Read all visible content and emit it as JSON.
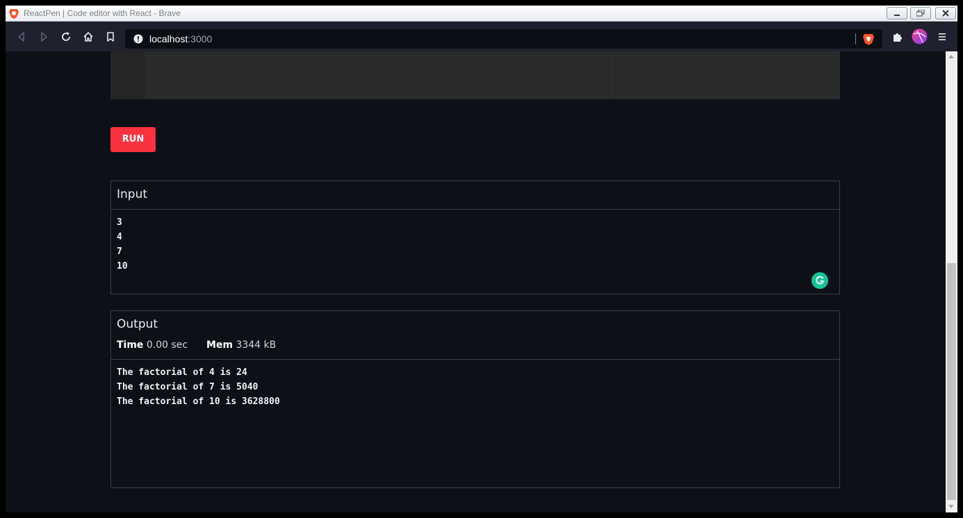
{
  "window": {
    "title": "ReactPen | Code editor with React - Brave"
  },
  "browser": {
    "url_host": "localhost",
    "url_port": ":3000",
    "icons": [
      "back-icon",
      "forward-icon",
      "reload-icon",
      "home-icon",
      "bookmark-icon",
      "info-icon",
      "brave-shield-icon",
      "extensions-icon",
      "profile-avatar",
      "menu-icon"
    ]
  },
  "main": {
    "run_label": "RUN",
    "input": {
      "title": "Input",
      "lines": [
        "3",
        "4",
        "7",
        "10"
      ]
    },
    "output": {
      "title": "Output",
      "time_label": "Time",
      "time_value": "0.00 sec",
      "mem_label": "Mem",
      "mem_value": "3344 kB",
      "lines": [
        "The factorial of 4 is 24",
        "The factorial of 7 is 5040",
        "The factorial of 10 is 3628800"
      ]
    }
  },
  "colors": {
    "accent": "#f8323f",
    "background": "#0d1017",
    "grammarly": "#15c39a"
  }
}
